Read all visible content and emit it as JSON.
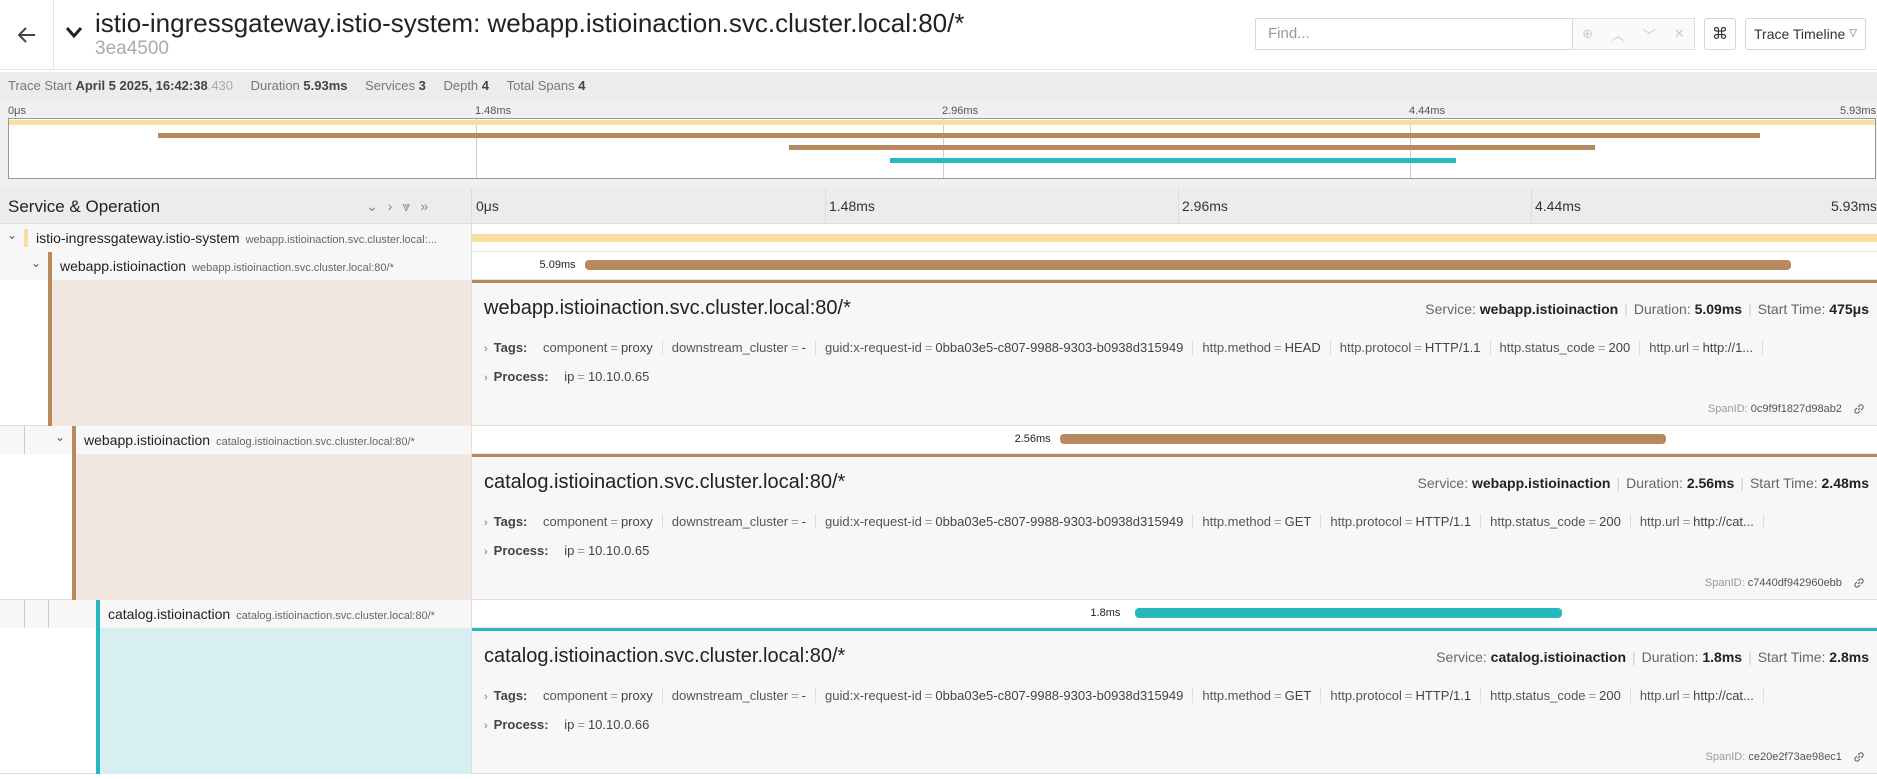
{
  "header": {
    "title": "istio-ingressgateway.istio-system: webapp.istioinaction.svc.cluster.local:80/*",
    "trace_id": "3ea4500",
    "find_placeholder": "Find...",
    "kbd_icon": "⌘",
    "view_select": "Trace Timeline"
  },
  "summary": {
    "trace_start_label": "Trace Start",
    "trace_start": "April 5 2025, 16:42:38",
    "trace_start_ms": ".430",
    "duration_label": "Duration",
    "duration": "5.93ms",
    "services_label": "Services",
    "services": "3",
    "depth_label": "Depth",
    "depth": "4",
    "total_spans_label": "Total Spans",
    "total_spans": "4"
  },
  "ticks": [
    "0μs",
    "1.48ms",
    "2.96ms",
    "4.44ms",
    "5.93ms"
  ],
  "table_header": {
    "label": "Service & Operation"
  },
  "colors": {
    "gateway": "#f9dda1",
    "webapp": "#b8895c",
    "catalog": "#25b9bd",
    "webapp_bg": "#f1e6e0",
    "catalog_bg": "#d7eff0"
  },
  "spans": [
    {
      "service": "istio-ingressgateway.istio-system",
      "operation": "webapp.istioinaction.svc.cluster.local:...",
      "start_ms": 0,
      "duration_ms": 5.93,
      "duration_label": "",
      "depth": 0
    },
    {
      "service": "webapp.istioinaction",
      "operation": "webapp.istioinaction.svc.cluster.local:80/*",
      "start_ms": 0.475,
      "duration_ms": 5.09,
      "duration_label": "5.09ms",
      "depth": 1
    },
    {
      "service": "webapp.istioinaction",
      "operation": "catalog.istioinaction.svc.cluster.local:80/*",
      "start_ms": 2.48,
      "duration_ms": 2.56,
      "duration_label": "2.56ms",
      "depth": 2
    },
    {
      "service": "catalog.istioinaction",
      "operation": "catalog.istioinaction.svc.cluster.local:80/*",
      "start_ms": 2.8,
      "duration_ms": 1.8,
      "duration_label": "1.8ms",
      "depth": 3
    }
  ],
  "details": [
    {
      "title": "webapp.istioinaction.svc.cluster.local:80/*",
      "service_label": "Service:",
      "service": "webapp.istioinaction",
      "duration_label": "Duration:",
      "duration": "5.09ms",
      "start_label": "Start Time:",
      "start": "475μs",
      "tags_label": "Tags:",
      "tags": [
        {
          "k": "component",
          "v": "proxy"
        },
        {
          "k": "downstream_cluster",
          "v": "-"
        },
        {
          "k": "guid:x-request-id",
          "v": "0bba03e5-c807-9988-9303-b0938d315949"
        },
        {
          "k": "http.method",
          "v": "HEAD"
        },
        {
          "k": "http.protocol",
          "v": "HTTP/1.1"
        },
        {
          "k": "http.status_code",
          "v": "200"
        },
        {
          "k": "http.url",
          "v": "http://1..."
        }
      ],
      "process_label": "Process:",
      "process_k": "ip",
      "process_v": "10.10.0.65",
      "spanid_label": "SpanID:",
      "spanid": "0c9f9f1827d98ab2"
    },
    {
      "title": "catalog.istioinaction.svc.cluster.local:80/*",
      "service_label": "Service:",
      "service": "webapp.istioinaction",
      "duration_label": "Duration:",
      "duration": "2.56ms",
      "start_label": "Start Time:",
      "start": "2.48ms",
      "tags_label": "Tags:",
      "tags": [
        {
          "k": "component",
          "v": "proxy"
        },
        {
          "k": "downstream_cluster",
          "v": "-"
        },
        {
          "k": "guid:x-request-id",
          "v": "0bba03e5-c807-9988-9303-b0938d315949"
        },
        {
          "k": "http.method",
          "v": "GET"
        },
        {
          "k": "http.protocol",
          "v": "HTTP/1.1"
        },
        {
          "k": "http.status_code",
          "v": "200"
        },
        {
          "k": "http.url",
          "v": "http://cat..."
        }
      ],
      "process_label": "Process:",
      "process_k": "ip",
      "process_v": "10.10.0.65",
      "spanid_label": "SpanID:",
      "spanid": "c7440df942960ebb"
    },
    {
      "title": "catalog.istioinaction.svc.cluster.local:80/*",
      "service_label": "Service:",
      "service": "catalog.istioinaction",
      "duration_label": "Duration:",
      "duration": "1.8ms",
      "start_label": "Start Time:",
      "start": "2.8ms",
      "tags_label": "Tags:",
      "tags": [
        {
          "k": "component",
          "v": "proxy"
        },
        {
          "k": "downstream_cluster",
          "v": "-"
        },
        {
          "k": "guid:x-request-id",
          "v": "0bba03e5-c807-9988-9303-b0938d315949"
        },
        {
          "k": "http.method",
          "v": "GET"
        },
        {
          "k": "http.protocol",
          "v": "HTTP/1.1"
        },
        {
          "k": "http.status_code",
          "v": "200"
        },
        {
          "k": "http.url",
          "v": "http://cat..."
        }
      ],
      "process_label": "Process:",
      "process_k": "ip",
      "process_v": "10.10.0.66",
      "spanid_label": "SpanID:",
      "spanid": "ce20e2f73ae98ec1"
    }
  ]
}
